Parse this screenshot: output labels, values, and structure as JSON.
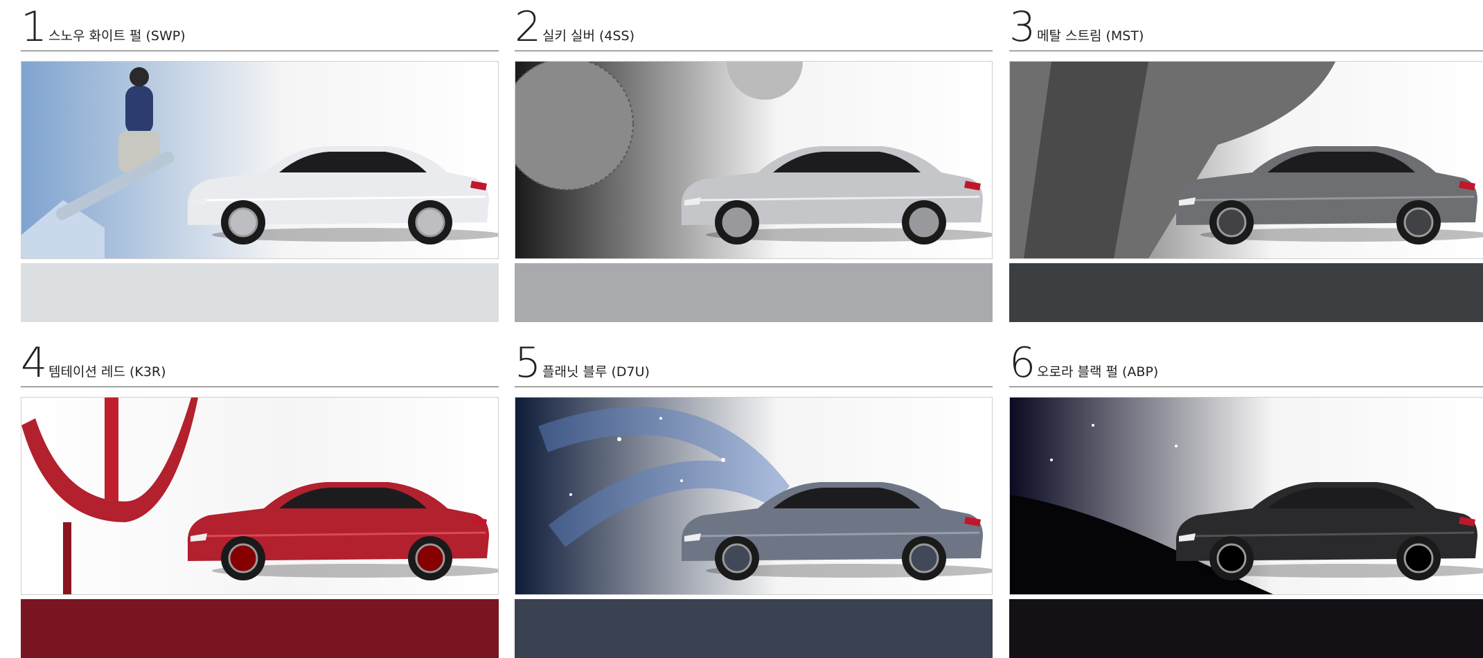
{
  "colors": [
    {
      "number": "1",
      "label": "스노우 화이트 펄 (SWP)",
      "car_color": "#e9ebee",
      "swatch_color": "#dcdfe1",
      "bg_from": "#7fa3cf",
      "bg_to": "#ffffff"
    },
    {
      "number": "2",
      "label": "실키 실버 (4SS)",
      "car_color": "#c4c6c9",
      "swatch_color": "#a8aaae",
      "bg_from": "#1a1a1a",
      "bg_to": "#ffffff"
    },
    {
      "number": "3",
      "label": "메탈 스트림 (MST)",
      "car_color": "#6d6f72",
      "swatch_color": "#3c3f42",
      "bg_from": "#3a3a3a",
      "bg_to": "#ffffff"
    },
    {
      "number": "4",
      "label": "템테이션 레드 (K3R)",
      "car_color": "#b3202e",
      "swatch_color": "#7a1522",
      "bg_from": "#ffffff",
      "bg_to": "#ffffff"
    },
    {
      "number": "5",
      "label": "플래닛 블루 (D7U)",
      "car_color": "#6e7686",
      "swatch_color": "#3a4150",
      "bg_from": "#0f1d3a",
      "bg_to": "#ffffff"
    },
    {
      "number": "6",
      "label": "오로라 블랙 펄 (ABP)",
      "car_color": "#2a2a2d",
      "swatch_color": "#141116",
      "bg_from": "#0a0a22",
      "bg_to": "#ffffff"
    }
  ]
}
